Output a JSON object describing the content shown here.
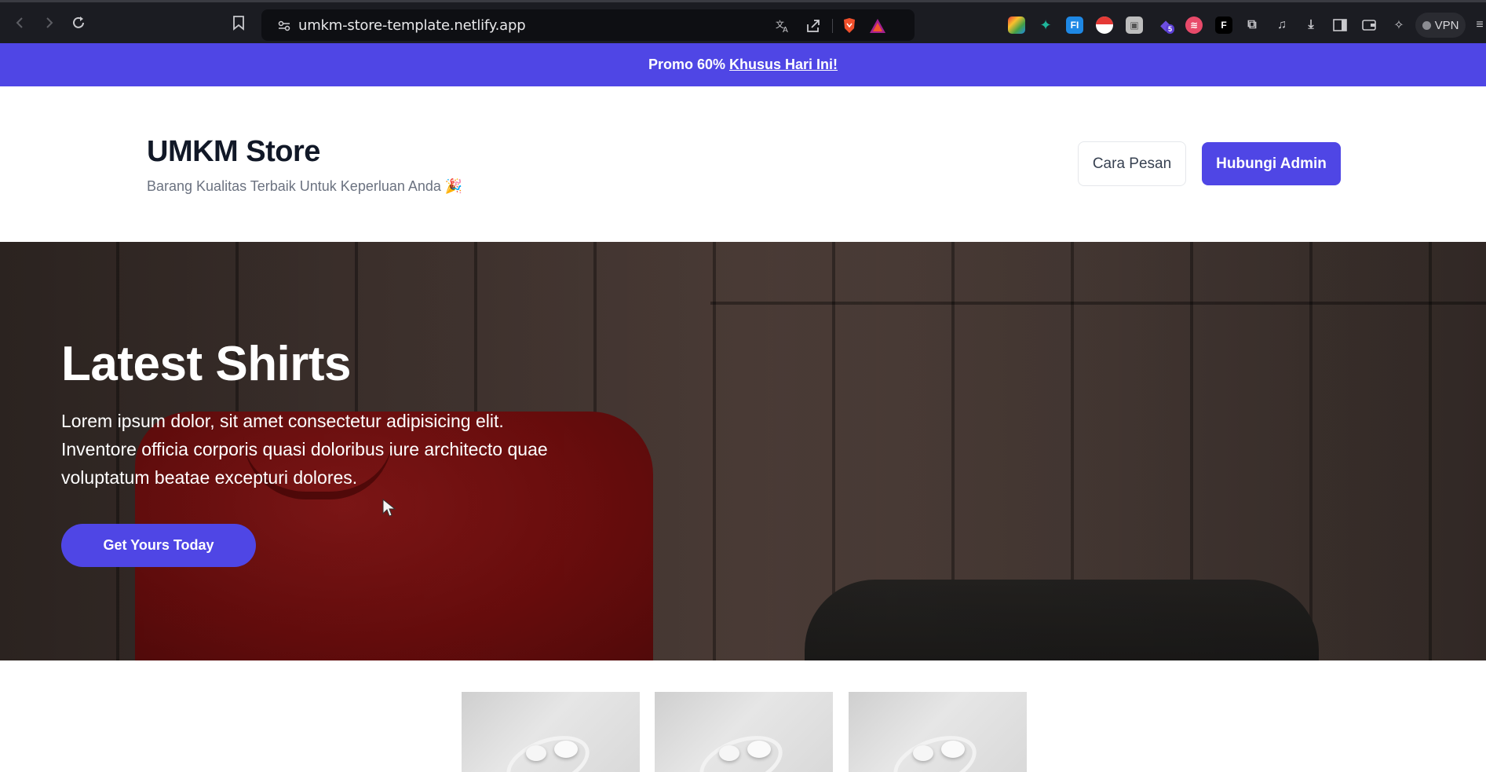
{
  "browser": {
    "url": "umkm-store-template.netlify.app",
    "vpn_label": "VPN",
    "extension_badge": "5"
  },
  "promo": {
    "text": "Promo 60%",
    "link_text": "Khusus Hari Ini!"
  },
  "header": {
    "title": "UMKM Store",
    "subtitle": "Barang Kualitas Terbaik Untuk Keperluan Anda 🎉",
    "how_to_order_label": "Cara Pesan",
    "contact_admin_label": "Hubungi Admin"
  },
  "hero": {
    "title": "Latest Shirts",
    "description": "Lorem ipsum dolor, sit amet consectetur adipisicing elit. Inventore officia corporis quasi doloribus iure architecto quae voluptatum beatae excepturi dolores.",
    "cta_label": "Get Yours Today"
  },
  "colors": {
    "accent": "#4f46e5",
    "chrome_bg": "#1b1c22",
    "address_bg": "#0e0f13"
  },
  "icons": [
    "back-icon",
    "forward-icon",
    "reload-icon",
    "bookmark-icon",
    "site-settings-icon",
    "translate-icon",
    "share-icon",
    "brave-shield-icon",
    "brave-rewards-icon"
  ]
}
